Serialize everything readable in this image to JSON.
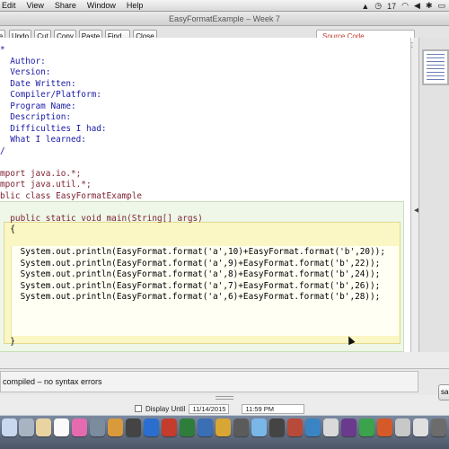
{
  "menubar": {
    "items": [
      "Edit",
      "View",
      "Share",
      "Window",
      "Help"
    ],
    "clock": "17"
  },
  "window": {
    "title": "EasyFormatExample – Week 7"
  },
  "toolbar": {
    "buttons": [
      "e",
      "Undo",
      "Cut",
      "Copy",
      "Paste",
      "Find...",
      "Close"
    ],
    "view_select": "Source Code"
  },
  "code": {
    "lines": [
      "*",
      "  Author:",
      "  Version:",
      "  Date Written:",
      "  Compiler/Platform:",
      "  Program Name:",
      "  Description:",
      "  Difficulties I had:",
      "  What I learned:",
      "/",
      "",
      "mport java.io.*;",
      "mport java.util.*;",
      "blic class EasyFormatExample",
      "",
      "  public static void main(String[] args)",
      "  {",
      "",
      "    System.out.println(EasyFormat.format('a',10)+EasyFormat.format('b',20));",
      "    System.out.println(EasyFormat.format('a',9)+EasyFormat.format('b',22));",
      "    System.out.println(EasyFormat.format('a',8)+EasyFormat.format('b',24));",
      "    System.out.println(EasyFormat.format('a',7)+EasyFormat.format('b',26));",
      "    System.out.println(EasyFormat.format('a',6)+EasyFormat.format('b',28));",
      "",
      "",
      "",
      "  }"
    ]
  },
  "status": {
    "message": "compiled – no syntax errors",
    "close_label": "sa",
    "display_until_label": "Display Until",
    "date": "11/14/2015",
    "time": "11:59 PM"
  },
  "colors": {
    "comment": "#1a1aa8",
    "keyword": "#7a1f2f",
    "class_bg": "#eef7e8",
    "method_bg": "#fbf7c4"
  }
}
